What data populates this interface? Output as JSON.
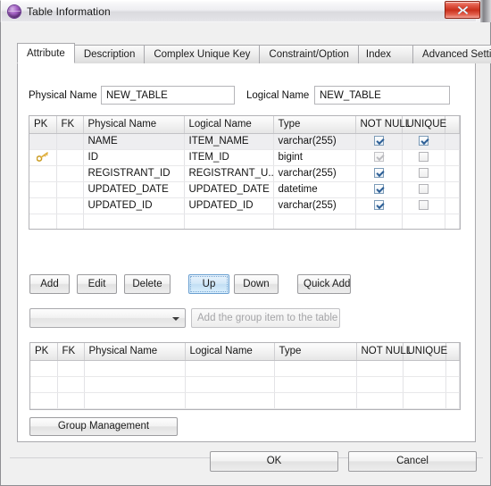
{
  "window": {
    "title": "Table Information",
    "icon": "sphere-icon",
    "close_label": "X"
  },
  "tabs": [
    {
      "label": "Attribute",
      "active": true
    },
    {
      "label": "Description",
      "active": false
    },
    {
      "label": "Complex Unique Key",
      "active": false
    },
    {
      "label": "Constraint/Option",
      "active": false
    },
    {
      "label": "Index",
      "active": false
    },
    {
      "label": "Advanced Settings",
      "active": false
    }
  ],
  "name_row": {
    "physical_label": "Physical Name",
    "physical_value": "NEW_TABLE",
    "logical_label": "Logical Name",
    "logical_value": "NEW_TABLE"
  },
  "columns_grid": {
    "headers": [
      "PK",
      "FK",
      "Physical Name",
      "Logical Name",
      "Type",
      "NOT NULL",
      "UNIQUE",
      ""
    ],
    "rows": [
      {
        "pk": "",
        "fk": "",
        "physical": "NAME",
        "logical": "ITEM_NAME",
        "type": "varchar(255)",
        "not_null": "checked",
        "unique": "checked",
        "selected": true
      },
      {
        "pk": "key-icon",
        "fk": "",
        "physical": "ID",
        "logical": "ITEM_ID",
        "type": "bigint",
        "not_null": "checked-disabled",
        "unique": "unchecked",
        "selected": false
      },
      {
        "pk": "",
        "fk": "",
        "physical": "REGISTRANT_ID",
        "logical": "REGISTRANT_U...",
        "type": "varchar(255)",
        "not_null": "checked",
        "unique": "unchecked",
        "selected": false
      },
      {
        "pk": "",
        "fk": "",
        "physical": "UPDATED_DATE",
        "logical": "UPDATED_DATE",
        "type": "datetime",
        "not_null": "checked",
        "unique": "unchecked",
        "selected": false
      },
      {
        "pk": "",
        "fk": "",
        "physical": "UPDATED_ID",
        "logical": "UPDATED_ID",
        "type": "varchar(255)",
        "not_null": "checked",
        "unique": "unchecked",
        "selected": false
      },
      {
        "pk": "",
        "fk": "",
        "physical": "",
        "logical": "",
        "type": "",
        "not_null": "",
        "unique": "",
        "selected": false
      },
      {
        "pk": "",
        "fk": "",
        "physical": "",
        "logical": "",
        "type": "",
        "not_null": "",
        "unique": "",
        "selected": false
      }
    ]
  },
  "row_buttons": {
    "add": "Add",
    "edit": "Edit",
    "delete": "Delete",
    "up": "Up",
    "down": "Down",
    "quick_add": "Quick Add"
  },
  "group_row": {
    "combo_value": "",
    "add_group_button": "Add the group item to the table",
    "add_group_disabled": true
  },
  "group_grid": {
    "headers": [
      "PK",
      "FK",
      "Physical Name",
      "Logical Name",
      "Type",
      "NOT NULL",
      "UNIQUE",
      ""
    ],
    "rows": [
      {
        "pk": "",
        "fk": "",
        "physical": "",
        "logical": "",
        "type": "",
        "not_null": "",
        "unique": ""
      },
      {
        "pk": "",
        "fk": "",
        "physical": "",
        "logical": "",
        "type": "",
        "not_null": "",
        "unique": ""
      },
      {
        "pk": "",
        "fk": "",
        "physical": "",
        "logical": "",
        "type": "",
        "not_null": "",
        "unique": ""
      }
    ]
  },
  "group_management_button": "Group Management",
  "footer": {
    "ok": "OK",
    "cancel": "Cancel"
  },
  "colors": {
    "focus_blue": "#6a9fd0",
    "close_red": "#c9301c",
    "icon_purple": "#a866c8",
    "key_gold": "#e0b040"
  }
}
